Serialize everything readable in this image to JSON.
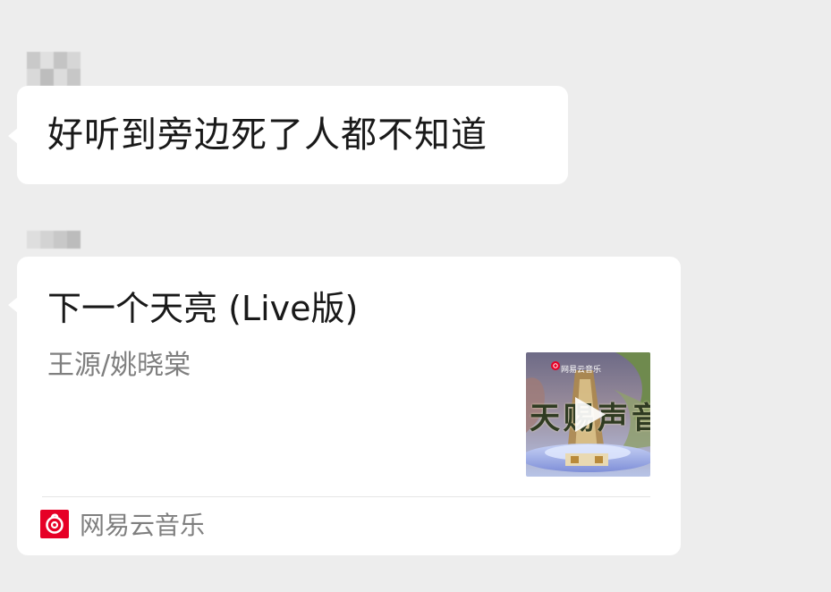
{
  "chat": {
    "message1": {
      "text": "好听到旁边死了人都不知道"
    },
    "message2": {
      "card": {
        "title": "下一个天亮 (Live版)",
        "artist": "王源/姚晓棠",
        "cover": {
          "brand_text": "网易云音乐",
          "show_text": "天赐声音",
          "icon": "play-icon"
        },
        "app": {
          "name": "网易云音乐",
          "icon": "netease-music-logo",
          "brand_color": "#e60026"
        }
      }
    }
  }
}
